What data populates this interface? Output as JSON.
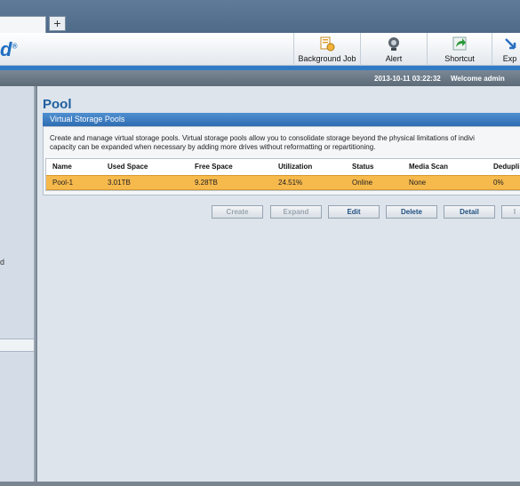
{
  "browser": {
    "new_tab_label": "+"
  },
  "header": {
    "logo_text": "d",
    "logo_mark": "®",
    "tools": [
      {
        "label": "Background Job",
        "icon": "background-job-icon"
      },
      {
        "label": "Alert",
        "icon": "alert-icon"
      },
      {
        "label": "Shortcut",
        "icon": "shortcut-icon"
      },
      {
        "label": "Exp",
        "icon": "export-icon"
      }
    ]
  },
  "status": {
    "datetime": "2013-10-11 03:22:32",
    "welcome": "Welcome admin"
  },
  "leftnav": {
    "partial_label": "d"
  },
  "page": {
    "title": "Pool",
    "panel_title": "Virtual Storage Pools",
    "description_line1": "Create and manage virtual storage pools. Virtual storage pools allow you to consolidate storage beyond the physical limitations of indivi",
    "description_line2": "capacity can be expanded when necessary by adding more drives without reformatting or repartitioning."
  },
  "table": {
    "columns": [
      "Name",
      "Used Space",
      "Free Space",
      "Utilization",
      "Status",
      "Media Scan",
      "Dedupli"
    ],
    "rows": [
      [
        "Pool-1",
        "3.01TB",
        "9.28TB",
        "24.51%",
        "Online",
        "None",
        "0%"
      ]
    ]
  },
  "actions": {
    "create": "Create",
    "expand": "Expand",
    "edit": "Edit",
    "delete": "Delete",
    "detail": "Detail",
    "info": "I"
  },
  "colors": {
    "accent": "#2f7bc6",
    "selected_row": "#f6b94c",
    "title": "#1f5f9e"
  }
}
